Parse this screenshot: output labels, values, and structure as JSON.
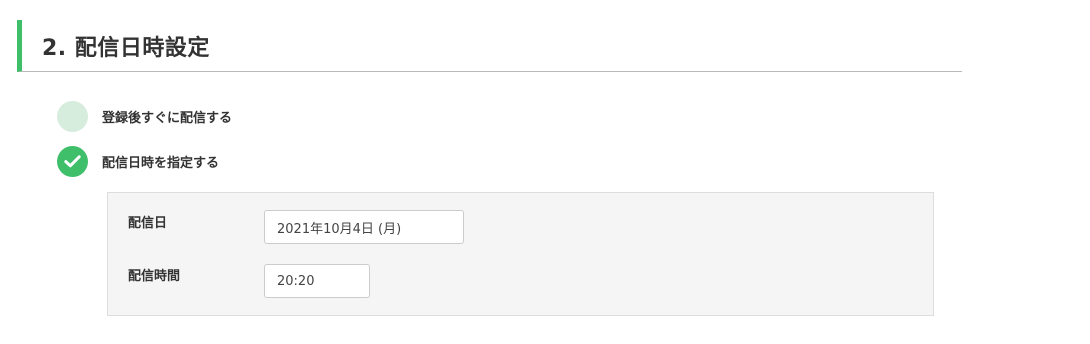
{
  "section": {
    "title": "2. 配信日時設定"
  },
  "delivery_options": [
    {
      "label": "登録後すぐに配信する",
      "selected": false
    },
    {
      "label": "配信日時を指定する",
      "selected": true
    }
  ],
  "schedule": {
    "date_label": "配信日",
    "date_value": "2021年10月4日 (月)",
    "time_label": "配信時間",
    "time_value": "20:20"
  },
  "colors": {
    "accent": "#3fbf6a",
    "unchecked_circle": "#d6ecdd",
    "panel_background": "#f5f5f5"
  },
  "icons": {
    "checked": "checkmark-icon"
  }
}
